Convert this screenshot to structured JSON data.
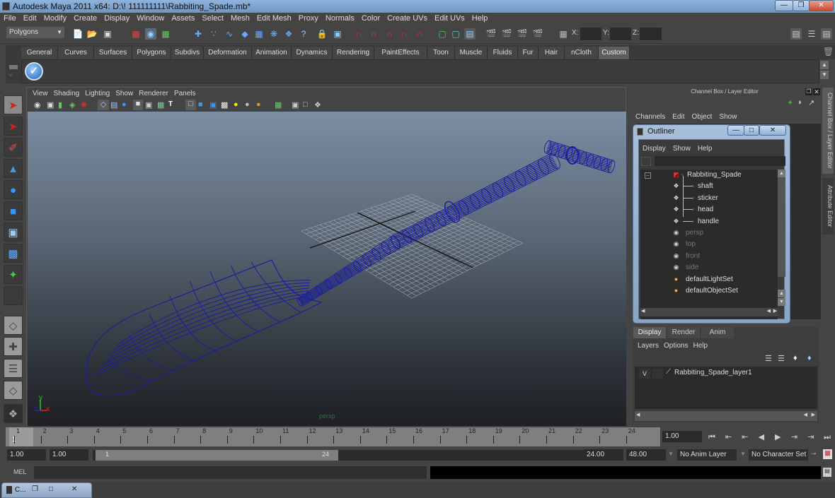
{
  "window": {
    "title": "Autodesk Maya 2011 x64: D:\\! 111111111\\Rabbiting_Spade.mb*",
    "minimize_icon": "minimize-icon",
    "maximize_icon": "restore-icon",
    "close_icon": "close-icon"
  },
  "menubar": [
    "File",
    "Edit",
    "Modify",
    "Create",
    "Display",
    "Window",
    "Assets",
    "Select",
    "Mesh",
    "Edit Mesh",
    "Proxy",
    "Normals",
    "Color",
    "Create UVs",
    "Edit UVs",
    "Help"
  ],
  "statusline": {
    "menuset": "Polygons",
    "x_label": "X:",
    "y_label": "Y:",
    "z_label": "Z:",
    "x_value": "",
    "y_value": "",
    "z_value": ""
  },
  "shelf": {
    "tabs": [
      "General",
      "Curves",
      "Surfaces",
      "Polygons",
      "Subdivs",
      "Deformation",
      "Animation",
      "Dynamics",
      "Rendering",
      "PaintEffects",
      "Toon",
      "Muscle",
      "Fluids",
      "Fur",
      "Hair",
      "nCloth",
      "Custom"
    ],
    "active_tab": "Custom",
    "items": [
      "checkmark-icon"
    ]
  },
  "toolbox": [
    "select-tool",
    "lasso-tool",
    "paint-select-tool",
    "move-tool",
    "rotate-tool",
    "scale-tool",
    "universal-manipulator",
    "soft-modification-tool",
    "show-manipulator-tool",
    "last-used-tool",
    "single-perspective-layout",
    "four-view-layout",
    "outliner-persp-layout",
    "persp-graph-layout",
    "maya-logo"
  ],
  "viewport": {
    "menu": [
      "View",
      "Shading",
      "Lighting",
      "Show",
      "Renderer",
      "Panels"
    ],
    "camera_label": "persp",
    "axis": {
      "y": "y",
      "x": "x",
      "z": "z"
    },
    "wire_color": "#1b1f9a"
  },
  "channelbox": {
    "title": "Channel Box / Layer Editor",
    "menu": [
      "Channels",
      "Edit",
      "Object",
      "Show"
    ],
    "side_tabs": [
      "Channel Box / Layer Editor",
      "Attribute Editor"
    ]
  },
  "outliner": {
    "title": "Outliner",
    "menu": [
      "Display",
      "Show",
      "Help"
    ],
    "search_value": "",
    "items": [
      {
        "label": "Rabbiting_Spade",
        "type": "group",
        "depth": 0,
        "dim": false,
        "expanded": true
      },
      {
        "label": "shaft",
        "type": "mesh",
        "depth": 1,
        "dim": false
      },
      {
        "label": "sticker",
        "type": "mesh",
        "depth": 1,
        "dim": false
      },
      {
        "label": "head",
        "type": "mesh",
        "depth": 1,
        "dim": false
      },
      {
        "label": "handle",
        "type": "mesh",
        "depth": 1,
        "dim": false
      },
      {
        "label": "persp",
        "type": "camera",
        "depth": 0,
        "dim": true
      },
      {
        "label": "top",
        "type": "camera",
        "depth": 0,
        "dim": true
      },
      {
        "label": "front",
        "type": "camera",
        "depth": 0,
        "dim": true
      },
      {
        "label": "side",
        "type": "camera",
        "depth": 0,
        "dim": true
      },
      {
        "label": "defaultLightSet",
        "type": "set",
        "depth": 0,
        "dim": false
      },
      {
        "label": "defaultObjectSet",
        "type": "set",
        "depth": 0,
        "dim": false
      }
    ]
  },
  "layer_editor": {
    "tabs": [
      "Display",
      "Render",
      "Anim"
    ],
    "active_tab": "Display",
    "menu": [
      "Layers",
      "Options",
      "Help"
    ],
    "layers": [
      {
        "visible": "V",
        "name": "Rabbiting_Spade_layer1"
      }
    ]
  },
  "timeslider": {
    "ticks": [
      "1",
      "2",
      "3",
      "4",
      "5",
      "6",
      "7",
      "8",
      "9",
      "10",
      "11",
      "12",
      "13",
      "14",
      "15",
      "16",
      "17",
      "18",
      "19",
      "20",
      "21",
      "22",
      "23",
      "24"
    ],
    "current_frame_marker": "1",
    "current_time": "1.00"
  },
  "playback": [
    "go-to-start-icon",
    "step-back-key-icon",
    "step-back-frame-icon",
    "play-backward-icon",
    "play-forward-icon",
    "step-forward-frame-icon",
    "step-forward-key-icon",
    "go-to-end-icon"
  ],
  "range": {
    "start_time": "1.00",
    "playback_start": "1.00",
    "range_start_label": "1",
    "range_end_label": "24",
    "playback_end": "24.00",
    "end_time": "48.00",
    "anim_layer": "No Anim Layer",
    "character_set": "No Character Set"
  },
  "command_line": {
    "label": "MEL",
    "value": "",
    "result": ""
  },
  "taskbar": {
    "label": "C..."
  }
}
